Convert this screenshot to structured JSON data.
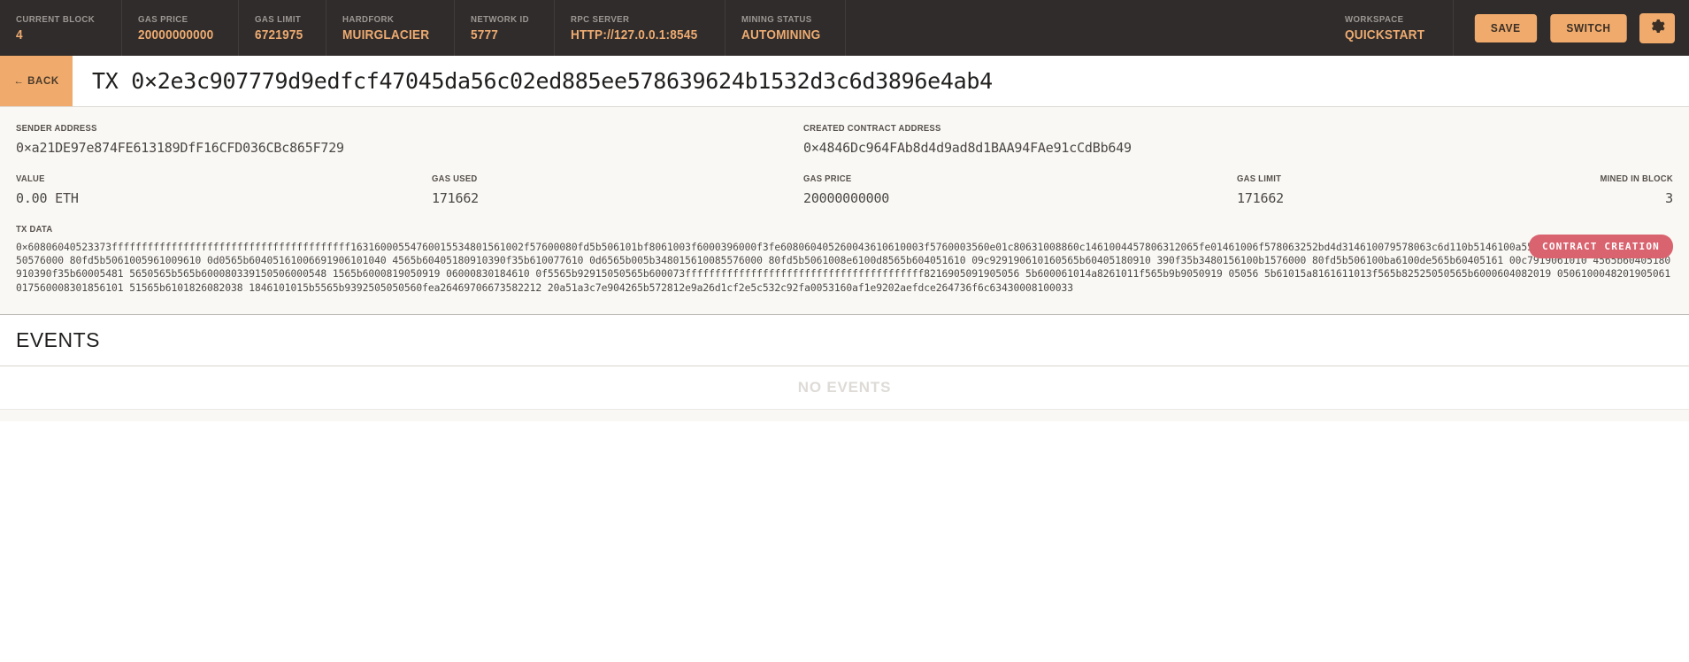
{
  "topbar": {
    "stats": [
      {
        "label": "CURRENT BLOCK",
        "value": "4"
      },
      {
        "label": "GAS PRICE",
        "value": "20000000000"
      },
      {
        "label": "GAS LIMIT",
        "value": "6721975"
      },
      {
        "label": "HARDFORK",
        "value": "MUIRGLACIER"
      },
      {
        "label": "NETWORK ID",
        "value": "5777"
      },
      {
        "label": "RPC SERVER",
        "value": "HTTP://127.0.0.1:8545"
      },
      {
        "label": "MINING STATUS",
        "value": "AUTOMINING"
      }
    ],
    "workspace": {
      "label": "WORKSPACE",
      "value": "QUICKSTART"
    },
    "save_label": "SAVE",
    "switch_label": "SWITCH",
    "settings_icon": "gear-icon"
  },
  "txheader": {
    "back_label": "← BACK",
    "title": "TX 0×2e3c907779d9edfcf47045da56c02ed885ee578639624b1532d3c6d3896e4ab4"
  },
  "details": {
    "sender_label": "SENDER ADDRESS",
    "sender_value": "0×a21DE97e874FE613189DfF16CFD036CBc865F729",
    "contract_label": "CREATED CONTRACT ADDRESS",
    "contract_value": "0×4846Dc964FAb8d4d9ad8d1BAA94FAe91cCdBb649",
    "badge": "CONTRACT CREATION",
    "value_label": "VALUE",
    "value_value": "0.00 ETH",
    "gas_used_label": "GAS USED",
    "gas_used_value": "171662",
    "gas_price_label": "GAS PRICE",
    "gas_price_value": "20000000000",
    "gas_limit_label": "GAS LIMIT",
    "gas_limit_value": "171662",
    "mined_in_block_label": "MINED IN BLOCK",
    "mined_in_block_value": "3",
    "txdata_label": "TX DATA",
    "txdata_value": "0×60806040523373ffffffffffffffffffffffffffffffffffffffff16316000554760015534801561002f57600080fd5b506101bf8061003f6000396000f3fe608060405260043610610003f5760003560e01c80631008860c1461004457806312065fe01461006f578063252bd4d314610079578063c6d110b5146100a5575b600080fd5b348015610050576000 80fd5b5061005961009610 0d0565b60405161006691906101040 4565b60405180910390f35b610077610 0d6565b005b348015610085576000 80fd5b5061008e6100d8565b604051610 09c929190610160565b60405180910 390f35b3480156100b1576000 80fd5b506100ba6100de565b60405161 00c7919061010 4565b60405180910390f35b60005481 5650565b565b600080339150506000548 1565b6000819050919 06000830184610 0f5565b92915050565b600073ffffffffffffffffffffffffffffffffffffffff8216905091905056 5b600061014a8261011f565b9b9050919 05056 5b61015a8161611013f565b82525050565b6000604082019 0506100048201905061017560008301856101 51565b6101826082038 1846101015b5565b9392505050560fea26469706673582212 20a51a3c7e904265b572812e9a26d1cf2e5c532c92fa0053160af1e9202aefdce264736f6c63430008100033"
  },
  "events": {
    "title": "EVENTS",
    "empty_message": "NO EVENTS"
  },
  "colors": {
    "topbar_bg": "#2f2c2b",
    "accent": "#f0ab6c",
    "accent_text": "#eeab71",
    "badge": "#d9636f",
    "panel_bg": "#faf8f4"
  }
}
